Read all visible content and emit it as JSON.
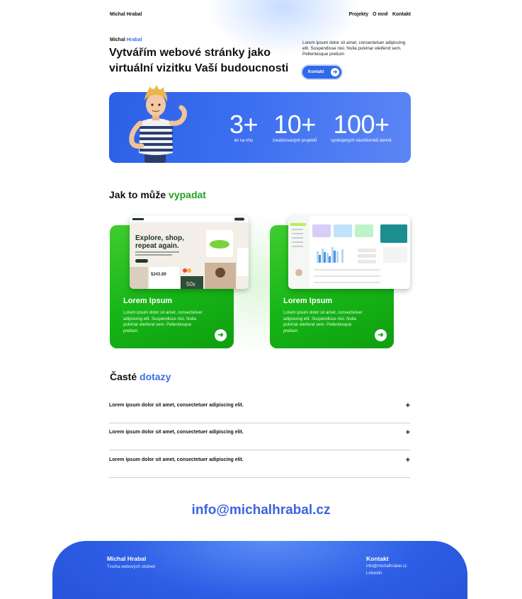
{
  "nav": {
    "brand": "Michal Hrabal",
    "links": [
      "Projekty",
      "O mně",
      "Kontakt"
    ]
  },
  "hero": {
    "tag_name": "Michal",
    "tag_accent": "Hrabal",
    "title": "Vytvářím webové stránky jako virtuální vizitku Vaší budoucnosti",
    "description": "Lorem ipsum dolor sit amet, consectetuer adipiscing elit. Suspendisse nisl. Nulla pulvinar eleifend sem. Pellentesque pretium",
    "button_label": "Kontakt",
    "button_icon": "arrow-right-icon"
  },
  "stats": [
    {
      "value": "3+",
      "label": "let na trhu"
    },
    {
      "value": "10+",
      "label": "zrealizovaných projektů"
    },
    {
      "value": "100+",
      "label": "spokojených návštěvníků denně"
    }
  ],
  "showcase": {
    "title_plain": "Jak to může",
    "title_accent": "vypadat",
    "cards": [
      {
        "title": "Lorem Ipsum",
        "description": "Lorem ipsum dolor sit amet, consectetuer adipiscing elit. Suspendisse nisl. Nulla pulvinar eleifend sem. Pellentesque pretium",
        "preview_heading": "Explore, shop, repeat again.",
        "preview_price": "$243.89",
        "preview_badge": "50x"
      },
      {
        "title": "Lorem Ipsum",
        "description": "Lorem ipsum dolor sit amet, consectetuer adipiscing elit. Suspendisse nisl. Nulla pulvinar eleifend sem. Pellentesque pretium"
      }
    ]
  },
  "faq": {
    "title_plain": "Časté",
    "title_accent": "dotazy",
    "items": [
      {
        "question": "Lorem ipsum dolor sit amet, consectetuer adipiscing elit.",
        "icon": "+"
      },
      {
        "question": "Lorem ipsum dolor sit amet, consectetuer adipiscing elit.",
        "icon": "+"
      },
      {
        "question": "Lorem ipsum dolor sit amet, consectetuer adipiscing elit.",
        "icon": "+"
      }
    ]
  },
  "contact_email": "info@michalhrabal.cz",
  "footer": {
    "brand": "Michal Hrabal",
    "tagline": "Tvorba webových stránek",
    "contact_title": "Kontakt",
    "email": "info@michalhrabal.cz",
    "linkedin": "Linkedin"
  },
  "colors": {
    "accent_blue": "#3d6fe8",
    "accent_green": "#1ea31e",
    "card_green": "#16b516"
  }
}
